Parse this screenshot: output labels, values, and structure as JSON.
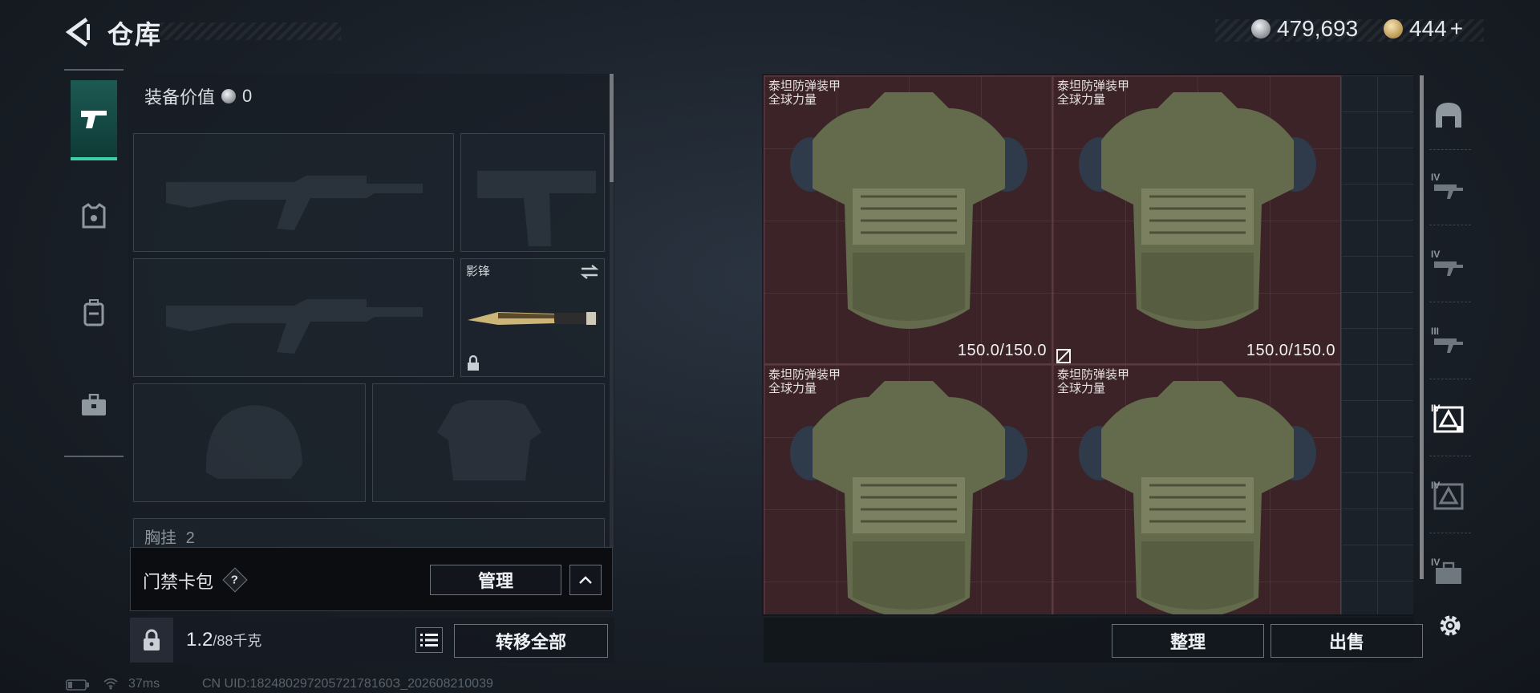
{
  "header": {
    "title": "仓库",
    "back_icon": "back-arrow-icon"
  },
  "currency": {
    "silver": "479,693",
    "gold": "444",
    "gold_add": "+"
  },
  "nav": {
    "items": [
      {
        "name": "weapons",
        "icon": "pistol-icon",
        "active": true
      },
      {
        "name": "armor",
        "icon": "vest-icon",
        "active": false
      },
      {
        "name": "backpack",
        "icon": "backpack-icon",
        "active": false
      },
      {
        "name": "case",
        "icon": "briefcase-icon",
        "active": false
      }
    ]
  },
  "loadout": {
    "equip_value_label": "装备价值",
    "equip_value": "0",
    "melee": {
      "name": "影锋",
      "swap_icon": "swap-icon",
      "lock_icon": "lock-icon"
    },
    "chest_rig_label": "胸挂",
    "chest_rig_count": "2"
  },
  "keycard": {
    "label": "门禁卡包",
    "help": "?",
    "manage_label": "管理"
  },
  "bottom": {
    "weight_value": "1.2",
    "weight_capacity": "/88千克",
    "transfer_all_label": "转移全部",
    "organize_label": "整理",
    "sell_label": "出售"
  },
  "stash": {
    "items": [
      {
        "name": "泰坦防弹装甲",
        "subtitle": "全球力量",
        "durability": "150.0/150.0"
      },
      {
        "name": "泰坦防弹装甲",
        "subtitle": "全球力量",
        "durability": "150.0/150.0"
      },
      {
        "name": "泰坦防弹装甲",
        "subtitle": "全球力量",
        "durability": ""
      },
      {
        "name": "泰坦防弹装甲",
        "subtitle": "全球力量",
        "durability": ""
      }
    ],
    "filters": [
      {
        "tier": "",
        "icon": "helmet-filter-icon"
      },
      {
        "tier": "IV",
        "icon": "rifle-filter-icon"
      },
      {
        "tier": "IV",
        "icon": "rifle-filter-icon"
      },
      {
        "tier": "III",
        "icon": "rifle-filter-icon"
      },
      {
        "tier": "IV",
        "icon": "armor-filter-icon",
        "active": true
      },
      {
        "tier": "IV",
        "icon": "armor-filter-icon"
      },
      {
        "tier": "IV",
        "icon": "case-filter-icon"
      }
    ]
  },
  "status": {
    "ping": "37ms",
    "uid": "CN UID:18248029720572178160З_202608210039"
  },
  "colors": {
    "accent": "#3fd0a8",
    "item_bg": "#3c2328",
    "panel": "#1b2129"
  }
}
